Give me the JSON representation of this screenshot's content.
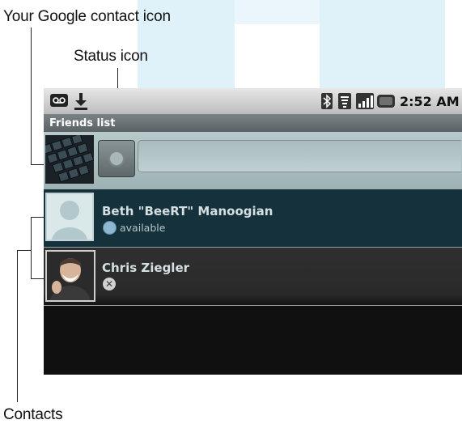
{
  "callouts": {
    "contact_icon": "Your Google contact icon",
    "status_icon": "Status icon",
    "contacts": "Contacts"
  },
  "statusbar": {
    "time": "2:52 AM",
    "left_icons": [
      "voicemail-icon",
      "download-icon"
    ],
    "right_icons": [
      "bluetooth-icon",
      "wifi-icon",
      "signal-icon",
      "battery-icon"
    ]
  },
  "titlebar": {
    "title": "Friends list"
  },
  "self": {
    "status_message_value": ""
  },
  "contacts": [
    {
      "name": "Beth \"BeeRT\" Manoogian",
      "status": "available",
      "status_color": "#8fb7cf"
    },
    {
      "name": "Chris Ziegler",
      "status": "",
      "status_color": "#cccccc"
    }
  ],
  "colors": {
    "screen_bg": "#101010",
    "row_dark_teal": "#15313b",
    "row_dark_gray": "#2a2a2a",
    "accent_blue": "#dff2fa"
  }
}
